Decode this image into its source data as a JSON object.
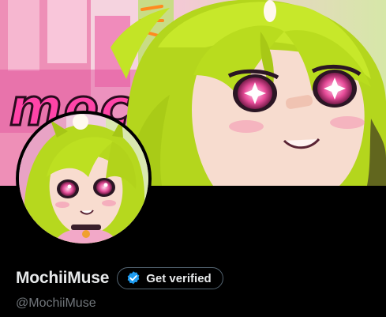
{
  "profile": {
    "display_name": "MochiiMuse",
    "handle": "@MochiiMuse",
    "verify_label": "Get verified",
    "banner_text": "mochi"
  },
  "colors": {
    "background": "#000000",
    "name_text": "#e7e9ea",
    "handle_text": "#71767b",
    "verify_badge": "#1d9bf0",
    "banner_pink": "#ef4aa6",
    "hair_green": "#b9dc1e"
  },
  "icons": {
    "verify": "verified-badge-icon"
  }
}
